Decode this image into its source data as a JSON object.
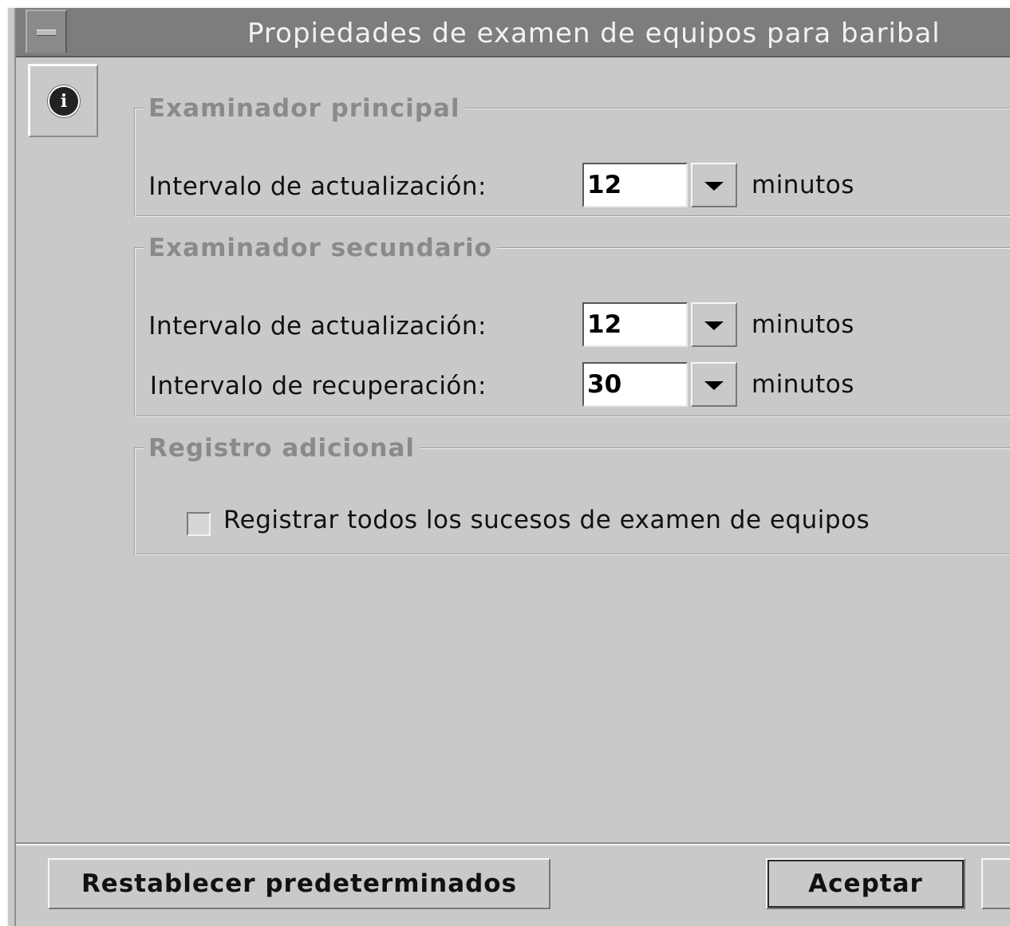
{
  "window": {
    "title": "Propiedades de examen de equipos para baribal",
    "menu_icon": "window-menu-icon",
    "info_icon": "info-icon"
  },
  "primary": {
    "legend": "Examinador principal",
    "update_label": "Intervalo de actualización:",
    "update_value": "12",
    "unit": "minutos"
  },
  "secondary": {
    "legend": "Examinador secundario",
    "update_label": "Intervalo de actualización:",
    "update_value": "12",
    "update_unit": "minutos",
    "recovery_label": "Intervalo de recuperación:",
    "recovery_value": "30",
    "recovery_unit": "minutos"
  },
  "logging": {
    "legend": "Registro adicional",
    "checkbox_label": "Registrar todos los sucesos de examen de equipos",
    "checked": false
  },
  "buttons": {
    "reset": "Restablecer predeterminados",
    "accept": "Aceptar"
  },
  "colors": {
    "background": "#c9c9c9",
    "titlebar": "#7d7d7d",
    "legend_text": "#8a8a8a"
  }
}
